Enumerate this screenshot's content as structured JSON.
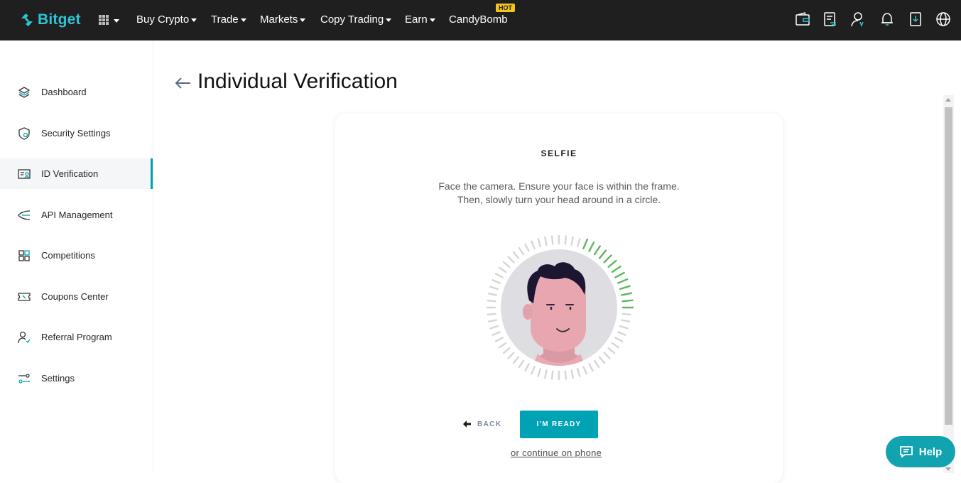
{
  "brand": {
    "name": "Bitget",
    "accent": "#2ec4d3"
  },
  "nav": {
    "items": [
      {
        "label": "Buy Crypto",
        "has_caret": true
      },
      {
        "label": "Trade",
        "has_caret": true
      },
      {
        "label": "Markets",
        "has_caret": true
      },
      {
        "label": "Copy Trading",
        "has_caret": true
      },
      {
        "label": "Earn",
        "has_caret": true
      },
      {
        "label": "CandyBomb",
        "has_caret": false,
        "badge": "HOT"
      }
    ],
    "right_icons": [
      "wallet-icon",
      "orders-icon",
      "user-icon",
      "bell-icon",
      "download-icon",
      "globe-icon"
    ]
  },
  "sidebar": {
    "items": [
      {
        "label": "Dashboard",
        "icon": "layers-icon"
      },
      {
        "label": "Security Settings",
        "icon": "shield-icon"
      },
      {
        "label": "ID Verification",
        "icon": "id-card-icon",
        "active": true
      },
      {
        "label": "API Management",
        "icon": "api-icon"
      },
      {
        "label": "Competitions",
        "icon": "grid-icon"
      },
      {
        "label": "Coupons Center",
        "icon": "ticket-icon"
      },
      {
        "label": "Referral Program",
        "icon": "referral-icon"
      },
      {
        "label": "Settings",
        "icon": "sliders-icon"
      }
    ]
  },
  "page": {
    "title": "Individual Verification"
  },
  "card": {
    "title": "SELFIE",
    "instruction_line1": "Face the camera. Ensure your face is within the frame.",
    "instruction_line2": "Then, slowly turn your head around in a circle.",
    "back_label": "BACK",
    "ready_label": "I'M READY",
    "phone_link": "or continue on phone"
  },
  "help": {
    "label": "Help"
  },
  "colors": {
    "primary": "#00a3b4",
    "progress": "#5cb85c",
    "nav_bg": "#1f1f1f"
  }
}
